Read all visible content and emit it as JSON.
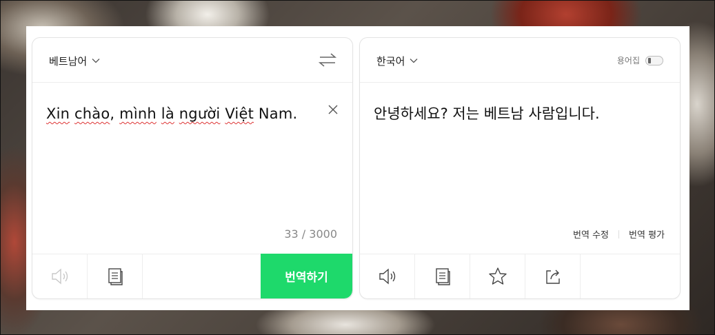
{
  "source": {
    "language": "베트남어",
    "text_words": [
      "Xin",
      " ",
      "chào",
      ", ",
      "mình",
      " ",
      "là",
      " ",
      "người",
      " ",
      "Việt",
      " Nam."
    ],
    "char_count": "33 / 3000",
    "translate_label": "번역하기"
  },
  "target": {
    "language": "한국어",
    "glossary_label": "용어집",
    "text": "안녕하세요? 저는 베트남 사람입니다.",
    "edit_label": "번역 수정",
    "rate_label": "번역 평가"
  },
  "icons": {
    "swap": "swap-icon",
    "clear": "close-icon",
    "speaker": "speaker-icon",
    "copy": "copy-icon",
    "star": "star-icon",
    "share": "share-icon",
    "chevron": "chevron-down-icon"
  },
  "colors": {
    "accent": "#1ed96b",
    "text": "#111111",
    "muted": "#888888",
    "spell_error": "#dd3333"
  }
}
